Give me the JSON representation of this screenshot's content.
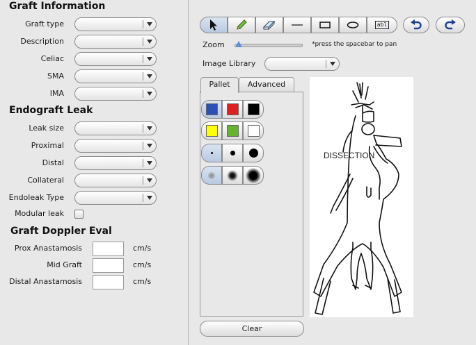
{
  "graft_information": {
    "title": "Graft Information",
    "fields": [
      {
        "label": "Graft type",
        "value": ""
      },
      {
        "label": "Description",
        "value": ""
      },
      {
        "label": "Celiac",
        "value": ""
      },
      {
        "label": "SMA",
        "value": ""
      },
      {
        "label": "IMA",
        "value": ""
      }
    ]
  },
  "endograft_leak": {
    "title": "Endograft Leak",
    "fields": [
      {
        "label": "Leak size",
        "value": ""
      },
      {
        "label": "Proximal",
        "value": ""
      },
      {
        "label": "Distal",
        "value": ""
      },
      {
        "label": "Collateral",
        "value": ""
      },
      {
        "label": "Endoleak Type",
        "value": ""
      }
    ],
    "modular_leak": {
      "label": "Modular leak",
      "checked": false
    }
  },
  "graft_doppler": {
    "title": "Graft Doppler Eval",
    "fields": [
      {
        "label": "Prox Anastamosis",
        "value": "",
        "unit": "cm/s"
      },
      {
        "label": "Mid Graft",
        "value": "",
        "unit": "cm/s"
      },
      {
        "label": "Distal Anastamosis",
        "value": "",
        "unit": "cm/s"
      }
    ]
  },
  "toolbar": {
    "tools": [
      {
        "name": "pointer-icon",
        "selected": true
      },
      {
        "name": "pencil-icon",
        "selected": false
      },
      {
        "name": "eraser-icon",
        "selected": false
      },
      {
        "name": "line-icon",
        "selected": false
      },
      {
        "name": "rectangle-icon",
        "selected": false
      },
      {
        "name": "ellipse-icon",
        "selected": false
      },
      {
        "name": "text-field-icon",
        "selected": false
      }
    ],
    "undo_icon": "undo-icon",
    "redo_icon": "redo-icon",
    "text_tool_glyph": "abl"
  },
  "zoom": {
    "label": "Zoom",
    "hint": "*press the spacebar to pan",
    "level": 0
  },
  "image_library": {
    "label": "Image Library",
    "value": ""
  },
  "tabs": [
    {
      "label": "Pallet",
      "active": true
    },
    {
      "label": "Advanced",
      "active": false
    }
  ],
  "pallet": {
    "colors": [
      "#2e4fb5",
      "#e02020",
      "#000000",
      "#ffff00",
      "#66b32e",
      "#ffffff"
    ],
    "selected_color": "#2e4fb5",
    "brush_sizes": [
      "small",
      "medium",
      "large"
    ],
    "soft_brushes": [
      "soft-small",
      "soft-medium",
      "soft-large"
    ]
  },
  "diagram": {
    "annotation": "DISSECTION"
  },
  "clear_label": "Clear"
}
